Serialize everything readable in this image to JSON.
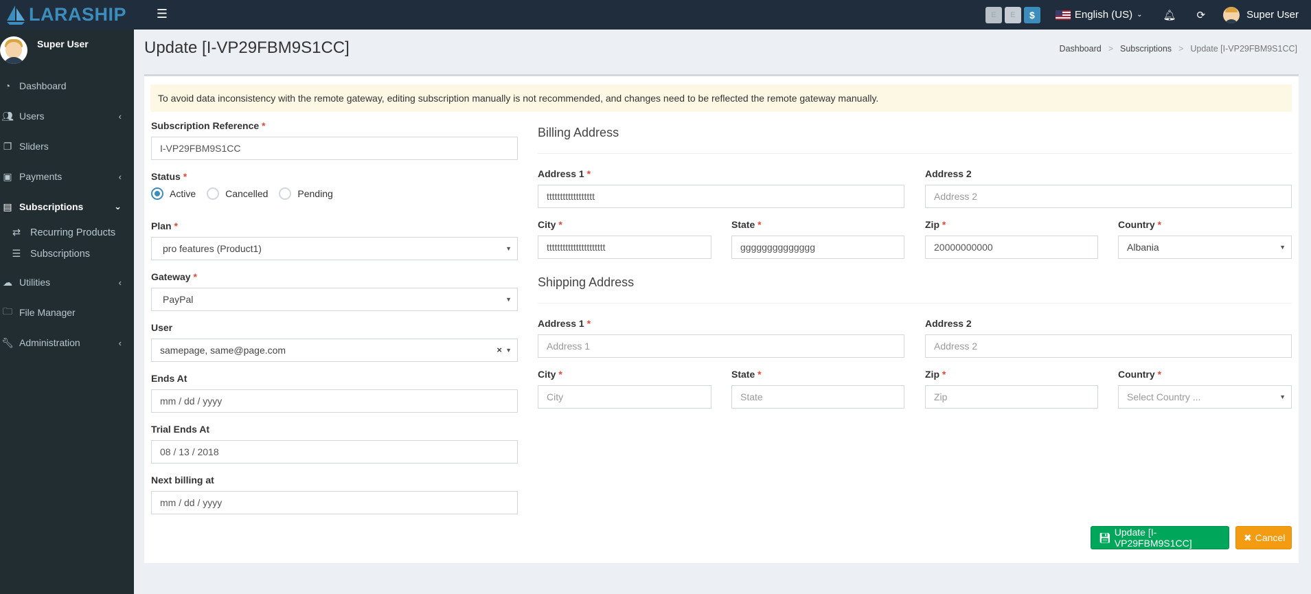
{
  "app": {
    "logo_text": "LARASHIP"
  },
  "topbar": {
    "btn_e1": "E",
    "btn_e2": "E",
    "btn_dollar": "$",
    "language": "English (US)",
    "user_name": "Super User"
  },
  "sidebar": {
    "user_name": "Super User",
    "items": [
      {
        "label": "Dashboard",
        "icon": "dashboard-icon"
      },
      {
        "label": "Users",
        "icon": "users-icon"
      },
      {
        "label": "Sliders",
        "icon": "sliders-icon"
      },
      {
        "label": "Payments",
        "icon": "payments-icon"
      },
      {
        "label": "Subscriptions",
        "icon": "subscriptions-icon"
      },
      {
        "label": "Utilities",
        "icon": "cloud-icon"
      },
      {
        "label": "File Manager",
        "icon": "folder-icon"
      },
      {
        "label": "Administration",
        "icon": "wrench-icon"
      }
    ],
    "subitems": [
      {
        "label": "Recurring Products",
        "icon": "recurring-icon"
      },
      {
        "label": "Subscriptions",
        "icon": "list-icon"
      }
    ]
  },
  "header": {
    "title": "Update [I-VP29FBM9S1CC]",
    "breadcrumb": [
      "Dashboard",
      "Subscriptions",
      "Update [I-VP29FBM9S1CC]"
    ]
  },
  "alert": "To avoid data inconsistency with the remote gateway, editing subscription manually is not recommended, and changes need to be reflected the remote gateway manually.",
  "form": {
    "subscription_reference": {
      "label": "Subscription Reference",
      "value": "I-VP29FBM9S1CC"
    },
    "status": {
      "label": "Status",
      "options": [
        "Active",
        "Cancelled",
        "Pending"
      ],
      "selected": "Active"
    },
    "plan": {
      "label": "Plan",
      "value": "pro features (Product1)"
    },
    "gateway": {
      "label": "Gateway",
      "value": "PayPal"
    },
    "user": {
      "label": "User",
      "value": "samepage, same@page.com"
    },
    "ends_at": {
      "label": "Ends At",
      "value": "mm / dd / yyyy"
    },
    "trial_ends_at": {
      "label": "Trial Ends At",
      "value": "08 / 13 / 2018"
    },
    "next_billing_at": {
      "label": "Next billing at",
      "value": "mm / dd / yyyy"
    }
  },
  "billing": {
    "title": "Billing Address",
    "address1": {
      "label": "Address 1",
      "value": "tttttttttttttttttt"
    },
    "address2": {
      "label": "Address 2",
      "placeholder": "Address 2"
    },
    "city": {
      "label": "City",
      "value": "tttttttttttttttttttttt"
    },
    "state": {
      "label": "State",
      "value": "gggggggggggggg"
    },
    "zip": {
      "label": "Zip",
      "value": "20000000000"
    },
    "country": {
      "label": "Country",
      "value": "Albania"
    }
  },
  "shipping": {
    "title": "Shipping Address",
    "address1": {
      "label": "Address 1",
      "placeholder": "Address 1"
    },
    "address2": {
      "label": "Address 2",
      "placeholder": "Address 2"
    },
    "city": {
      "label": "City",
      "placeholder": "City"
    },
    "state": {
      "label": "State",
      "placeholder": "State"
    },
    "zip": {
      "label": "Zip",
      "placeholder": "Zip"
    },
    "country": {
      "label": "Country",
      "placeholder": "Select Country ..."
    }
  },
  "actions": {
    "update_label": "Update [I-VP29FBM9S1CC]",
    "cancel_label": "Cancel"
  },
  "colors": {
    "navbar": "#1f2d3d",
    "sidebar": "#222d32",
    "primary": "#3c8dbc",
    "success": "#00a65a",
    "warning": "#f39c12",
    "required": "#dd4b39"
  }
}
